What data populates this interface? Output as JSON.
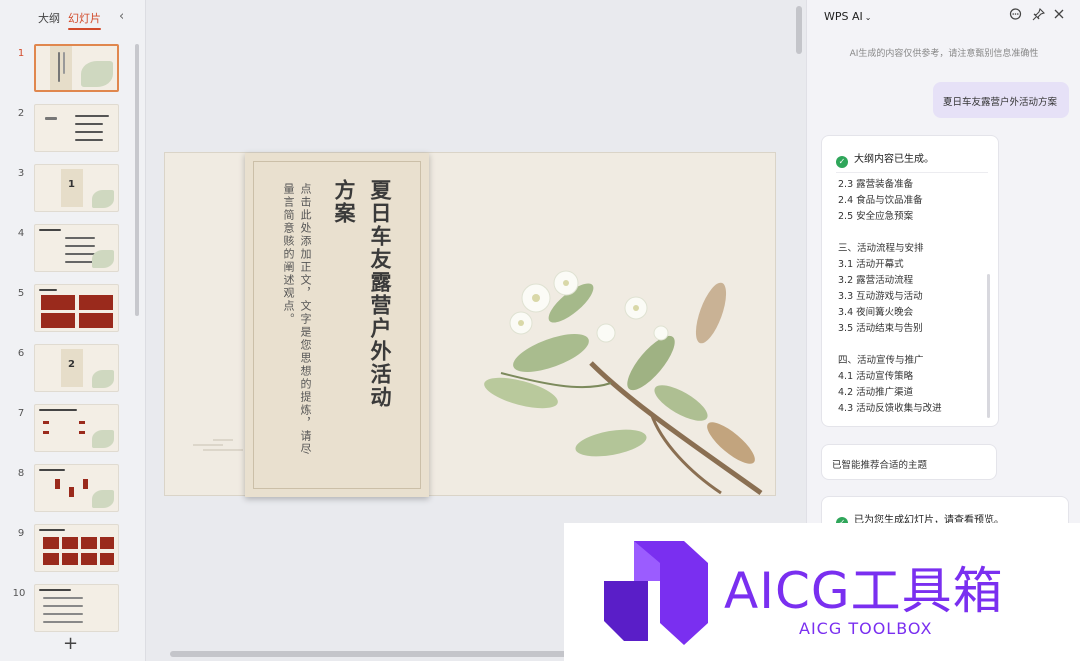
{
  "left_panel": {
    "tab_outline": "大纲",
    "tab_slides": "幻灯片",
    "collapse_icon": "chevron-left-icon",
    "slide_numbers": [
      "1",
      "2",
      "3",
      "4",
      "5",
      "6",
      "7",
      "8",
      "9",
      "10"
    ],
    "active_slide": 1,
    "thumb_numbers": {
      "s3": "1",
      "s6": "2"
    },
    "add_label": "+"
  },
  "slide": {
    "title_line1": "夏日车友露营户外活动",
    "title_line2": "方案",
    "body_line1": "点击此处添加正文，文字是您思想的提炼，请尽",
    "body_line2": "量言简意赅的阐述观点。"
  },
  "ai_panel": {
    "title": "WPS AI",
    "caret": "⌄",
    "icons": [
      "chat-icon",
      "pin-icon",
      "close-icon"
    ],
    "disclaimer": "AI生成的内容仅供参考，请注意甄别信息准确性",
    "user_message": "夏日车友露营户外活动方案",
    "outline_status": "大纲内容已生成。",
    "outline_lines": [
      "2.3 露营装备准备",
      "2.4 食品与饮品准备",
      "2.5 安全应急预案",
      "",
      "三、活动流程与安排",
      "3.1 活动开幕式",
      "3.2 露营活动流程",
      "3.3 互动游戏与活动",
      "3.4 夜间篝火晚会",
      "3.5 活动结束与告别",
      "",
      "四、活动宣传与推广",
      "4.1 活动宣传策略",
      "4.2 活动推广渠道",
      "4.3 活动反馈收集与改进"
    ],
    "theme_message": "已智能推荐合适的主题",
    "generated_message": "已为您生成幻灯片，请查看预览。"
  },
  "watermark": {
    "title": "AICG工具箱",
    "subtitle": "AICG TOOLBOX"
  },
  "colors": {
    "accent": "#d24a2a",
    "ai_purple": "#7a2ff0",
    "check_green": "#2fa65a"
  }
}
